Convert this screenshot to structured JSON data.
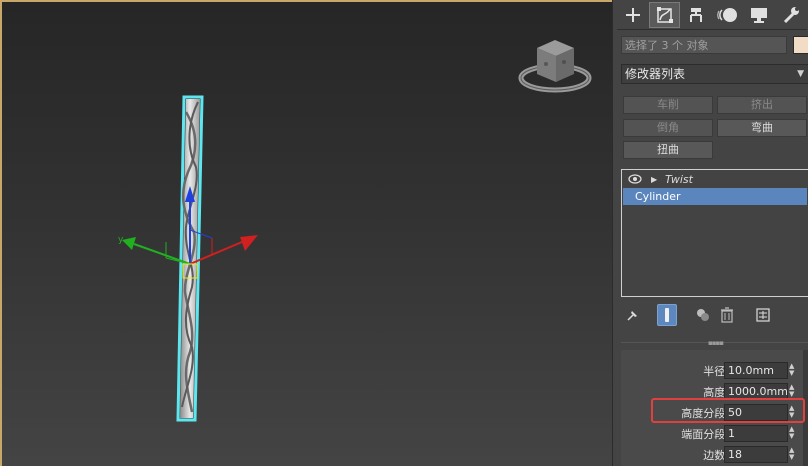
{
  "panel": {
    "tabs": [
      {
        "name": "create-tab",
        "icon": "plus-icon"
      },
      {
        "name": "modify-tab",
        "icon": "modify-icon",
        "active": true
      },
      {
        "name": "hierarchy-tab",
        "icon": "hierarchy-icon"
      },
      {
        "name": "motion-tab",
        "icon": "motion-icon"
      },
      {
        "name": "display-tab",
        "icon": "display-icon"
      },
      {
        "name": "utilities-tab",
        "icon": "wrench-icon"
      }
    ],
    "selection_name": "选择了 3 个 对象",
    "object_color": "#f3dcc6",
    "modifier_list": "修改器列表",
    "modifier_buttons": [
      {
        "label": "车削",
        "enabled": false
      },
      {
        "label": "挤出",
        "enabled": false
      },
      {
        "label": "倒角",
        "enabled": false
      },
      {
        "label": "弯曲",
        "enabled": true
      },
      {
        "label": "扭曲",
        "enabled": true
      }
    ],
    "stack": {
      "modifier": "Twist",
      "base_object": "Cylinder"
    },
    "parameters": [
      {
        "label": "半径:",
        "value": "10.0mm"
      },
      {
        "label": "高度:",
        "value": "1000.0mm"
      },
      {
        "label": "高度分段:",
        "value": "50"
      },
      {
        "label": "端面分段:",
        "value": "1"
      },
      {
        "label": "边数:",
        "value": "18"
      }
    ]
  },
  "viewport": {
    "gizmo_colors": {
      "x": "#d02020",
      "y": "#20b020",
      "z": "#2040e0"
    },
    "selection_color": "#5ee6f0"
  }
}
